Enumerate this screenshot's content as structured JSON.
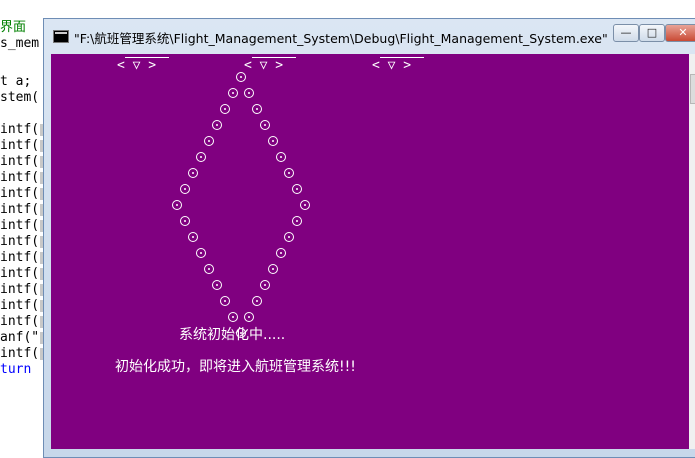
{
  "editor": {
    "lines": [
      {
        "text": "界面",
        "kind": "cmt"
      },
      {
        "text": "s_mem",
        "kind": "plain"
      },
      {
        "text": "",
        "kind": "plain"
      },
      {
        "text": "t a;",
        "kind": "plain",
        "kw": "t"
      },
      {
        "text": "stem(",
        "kind": "plain"
      },
      {
        "text": "",
        "kind": "plain"
      },
      {
        "text": "intf(",
        "kind": "plain"
      },
      {
        "text": "intf(",
        "kind": "plain"
      },
      {
        "text": "intf(",
        "kind": "plain"
      },
      {
        "text": "intf(",
        "kind": "plain"
      },
      {
        "text": "intf(",
        "kind": "plain"
      },
      {
        "text": "intf(",
        "kind": "plain"
      },
      {
        "text": "intf(",
        "kind": "plain"
      },
      {
        "text": "intf(",
        "kind": "plain"
      },
      {
        "text": "intf(",
        "kind": "plain"
      },
      {
        "text": "intf(",
        "kind": "plain"
      },
      {
        "text": "intf(",
        "kind": "plain"
      },
      {
        "text": "intf(",
        "kind": "plain"
      },
      {
        "text": "intf(",
        "kind": "plain"
      },
      {
        "text": "anf(\"",
        "kind": "plain"
      },
      {
        "text": "intf(",
        "kind": "plain"
      },
      {
        "text": "turn",
        "kind": "kw"
      }
    ]
  },
  "window": {
    "title": "\"F:\\航班管理系统\\Flight_Management_System\\Debug\\Flight_Management_System.exe\"",
    "minimize_label": "—",
    "maximize_label": "□",
    "close_label": "✕"
  },
  "console": {
    "background": "#800080",
    "faces": [
      "< ▽ >",
      "< ▽ >",
      "< ▽ >"
    ],
    "loading_text": "系统初始化中.....",
    "success_text": "初始化成功，即将进入航班管理系统!!!"
  }
}
